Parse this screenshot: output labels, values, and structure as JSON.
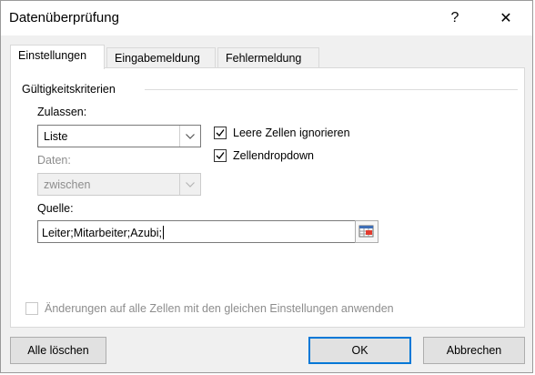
{
  "window": {
    "title": "Datenüberprüfung",
    "help_glyph": "?",
    "close_glyph": "✕"
  },
  "tabs": [
    {
      "label": "Einstellungen",
      "active": true
    },
    {
      "label": "Eingabemeldung",
      "active": false
    },
    {
      "label": "Fehlermeldung",
      "active": false
    }
  ],
  "settings": {
    "group_label": "Gültigkeitskriterien",
    "allow_label": "Zulassen:",
    "allow_value": "Liste",
    "data_label": "Daten:",
    "data_value": "zwischen",
    "ignore_blank_label": "Leere Zellen ignorieren",
    "ignore_blank_checked": true,
    "dropdown_label": "Zellendropdown",
    "dropdown_checked": true,
    "source_label": "Quelle:",
    "source_value": "Leiter;Mitarbeiter;Azubi;",
    "apply_all_label": "Änderungen auf alle Zellen mit den gleichen Einstellungen anwenden",
    "apply_all_checked": false
  },
  "buttons": {
    "clear_all": "Alle löschen",
    "ok": "OK",
    "cancel": "Abbrechen"
  },
  "icons": {
    "dropdown": "chevron-down-icon",
    "range_picker": "range-select-icon"
  }
}
